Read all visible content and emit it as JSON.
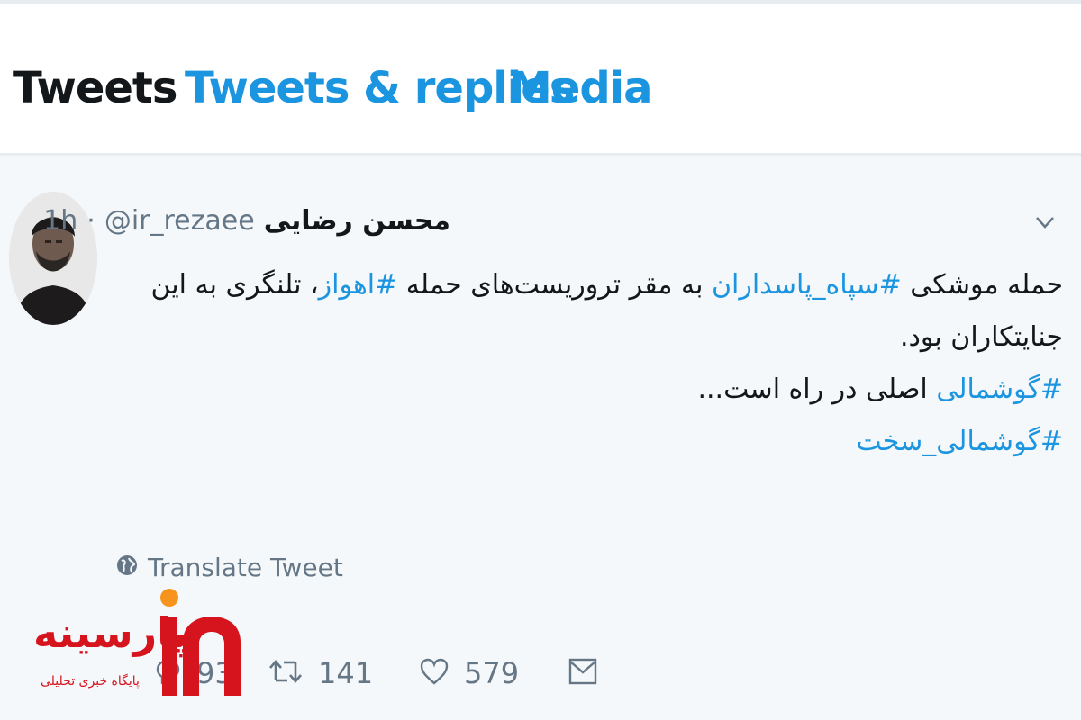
{
  "tabs": [
    {
      "label": "Tweets",
      "active": true
    },
    {
      "label": "Tweets & replies",
      "active": false
    },
    {
      "label": "Media",
      "active": false
    }
  ],
  "tweet": {
    "author_name": "محسن رضایی",
    "handle": "@ir_rezaee",
    "separator": "·",
    "time": "1h",
    "lines": [
      {
        "t1": "حمله موشکی ",
        "h1": "#سپاه_پاسداران",
        "t2": " به مقر تروریست‌های حمله ",
        "h2": "#اهواز",
        "t3": "، تلنگری به این"
      },
      {
        "t1": "جنایتکاران بود."
      },
      {
        "h1": "#گوشمالی",
        "t2": " اصلی در راه است..."
      },
      {
        "h1": "#گوشمالی_سخت"
      }
    ],
    "translate_label": "Translate Tweet",
    "stats": {
      "replies": "93",
      "retweets": "141",
      "likes": "579"
    }
  },
  "watermark": {
    "title": "پارسینه",
    "subtitle": "پایگاه خبری تحلیلی"
  },
  "colors": {
    "link": "#1b95e0",
    "text": "#14171a",
    "muted": "#657786",
    "tweet_bg": "#f5f8fa",
    "watermark": "#d6141e",
    "watermark_accent": "#f7941d"
  },
  "icons": {
    "caret": "chevron-down-icon",
    "translate": "globe-icon",
    "reply": "reply-icon",
    "retweet": "retweet-icon",
    "like": "heart-icon",
    "dm": "mail-icon"
  }
}
